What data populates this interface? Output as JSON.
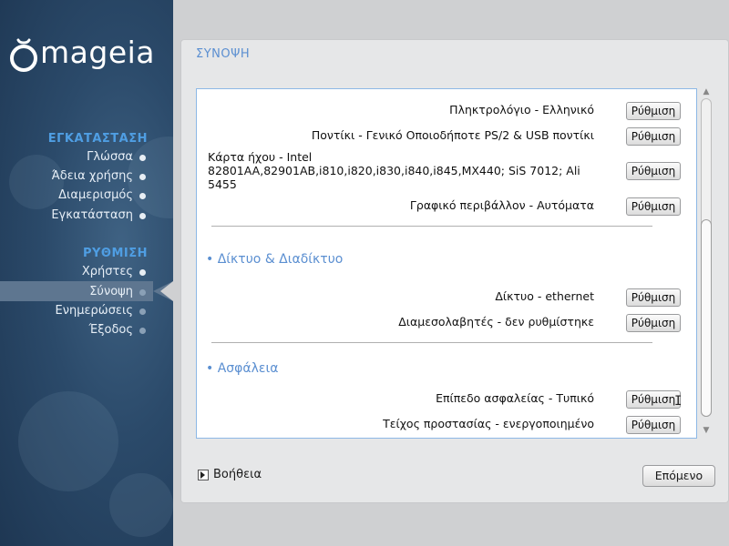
{
  "brand": {
    "name": "mageia",
    "accent": "#4f9ee3"
  },
  "sidebar": {
    "sections": [
      {
        "title": "ΕΓΚΑΤΑΣΤΑΣΗ",
        "items": [
          {
            "label": "Γλώσσα",
            "state": "done"
          },
          {
            "label": "Άδεια χρήσης",
            "state": "done"
          },
          {
            "label": "Διαμερισμός",
            "state": "done"
          },
          {
            "label": "Εγκατάσταση",
            "state": "done"
          }
        ]
      },
      {
        "title": "ΡΥΘΜΙΣΗ",
        "items": [
          {
            "label": "Χρήστες",
            "state": "done"
          },
          {
            "label": "Σύνοψη",
            "state": "current"
          },
          {
            "label": "Ενημερώσεις",
            "state": "pending"
          },
          {
            "label": "Έξοδος",
            "state": "pending"
          }
        ]
      }
    ]
  },
  "main": {
    "title": "ΣΥΝΟΨΗ",
    "configure_label": "Ρύθμιση",
    "rows_hardware": [
      {
        "label": "Πληκτρολόγιο - Ελληνικό"
      },
      {
        "label": "Ποντίκι - Γενικό Οποιοδήποτε PS/2 & USB ποντίκι"
      },
      {
        "label": "Κάρτα ήχου - Intel 82801AA,82901AB,i810,i820,i830,i840,i845,MX440; SiS 7012; Ali 5455"
      },
      {
        "label": "Γραφικό περιβάλλον - Αυτόματα"
      }
    ],
    "cat_network": "• Δίκτυο & Διαδίκτυο",
    "rows_network": [
      {
        "label": "Δίκτυο - ethernet"
      },
      {
        "label": "Διαμεσολαβητές - δεν ρυθμίστηκε"
      }
    ],
    "cat_security": "• Ασφάλεια",
    "rows_security": [
      {
        "label": "Επίπεδο ασφαλείας - Τυπικό"
      },
      {
        "label": "Τείχος προστασίας - ενεργοποιημένο"
      }
    ]
  },
  "footer": {
    "help_label": "Βοήθεια",
    "next_label": "Επόμενο"
  },
  "icons": {
    "help": "triangle-right-icon",
    "cursor": "text-cursor-icon"
  }
}
